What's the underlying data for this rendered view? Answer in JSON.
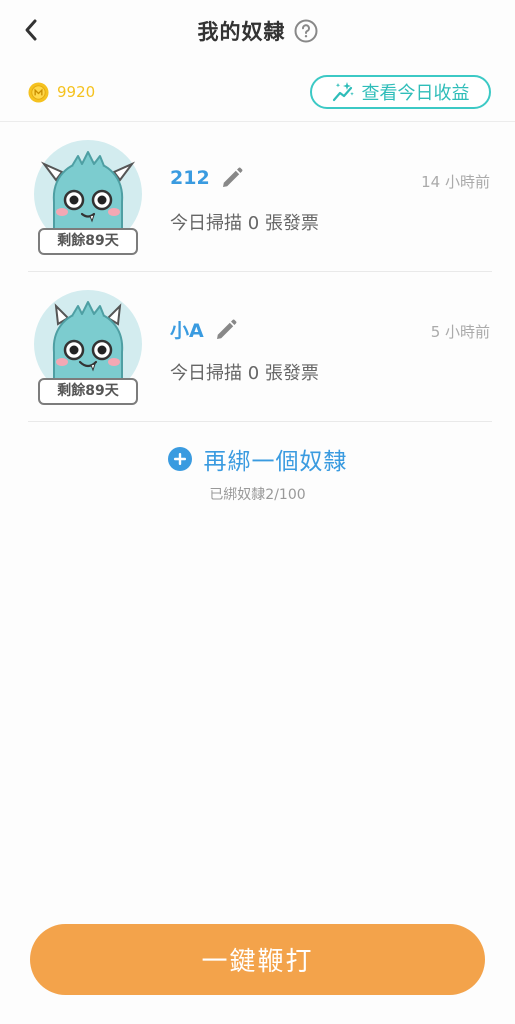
{
  "header": {
    "title": "我的奴隸"
  },
  "wallet": {
    "balance": "9920",
    "earnings_label": "查看今日收益"
  },
  "slaves": [
    {
      "name": "212",
      "time": "14 小時前",
      "scan_text": "今日掃描 0 張發票",
      "days_left": "剩餘89天"
    },
    {
      "name": "小A",
      "time": "5 小時前",
      "scan_text": "今日掃描 0 張發票",
      "days_left": "剩餘89天"
    }
  ],
  "add": {
    "label": "再綁一個奴隸",
    "count_text": "已綁奴隸2/100"
  },
  "footer": {
    "whip_label": "一鍵鞭打"
  },
  "colors": {
    "accent_blue": "#3a9be0",
    "teal": "#3cc9c5",
    "orange": "#f3a34b",
    "coin": "#f5c21f"
  },
  "icons": [
    "back-icon",
    "help-icon",
    "coin-icon",
    "sparkle-chart-icon",
    "edit-icon",
    "plus-circle-icon",
    "monster-avatar"
  ]
}
